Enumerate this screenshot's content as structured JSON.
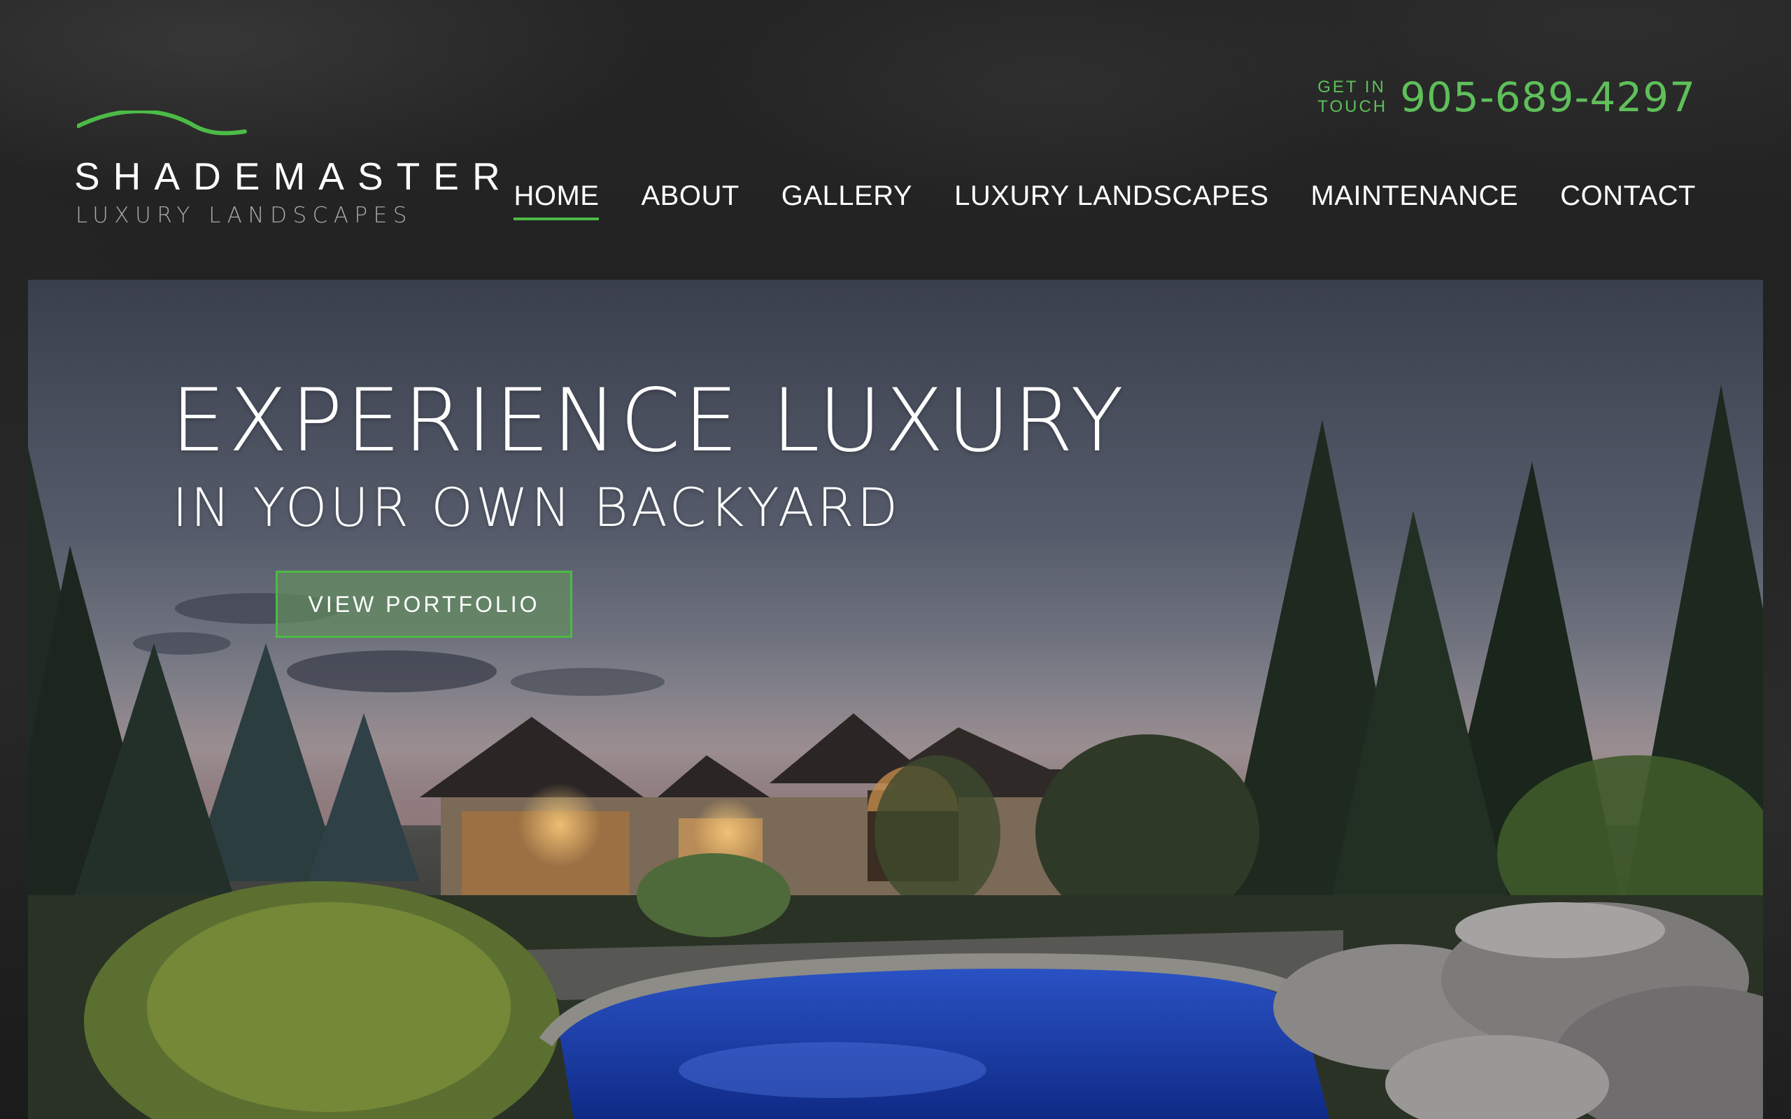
{
  "brand": {
    "name": "SHADEMASTER",
    "tagline": "LUXURY LANDSCAPES",
    "accent_color": "#4cbb46",
    "logo_icon": "green-arc-icon"
  },
  "contact": {
    "label_line1": "GET IN",
    "label_line2": "TOUCH",
    "phone": "905-689-4297"
  },
  "nav": {
    "items": [
      {
        "label": "HOME",
        "active": true
      },
      {
        "label": "ABOUT",
        "active": false
      },
      {
        "label": "GALLERY",
        "active": false
      },
      {
        "label": "LUXURY LANDSCAPES",
        "active": false
      },
      {
        "label": "MAINTENANCE",
        "active": false
      },
      {
        "label": "CONTACT",
        "active": false
      }
    ]
  },
  "hero": {
    "title": "EXPERIENCE LUXURY",
    "subtitle": "IN YOUR OWN BACKYARD",
    "cta_label": "VIEW PORTFOLIO"
  }
}
